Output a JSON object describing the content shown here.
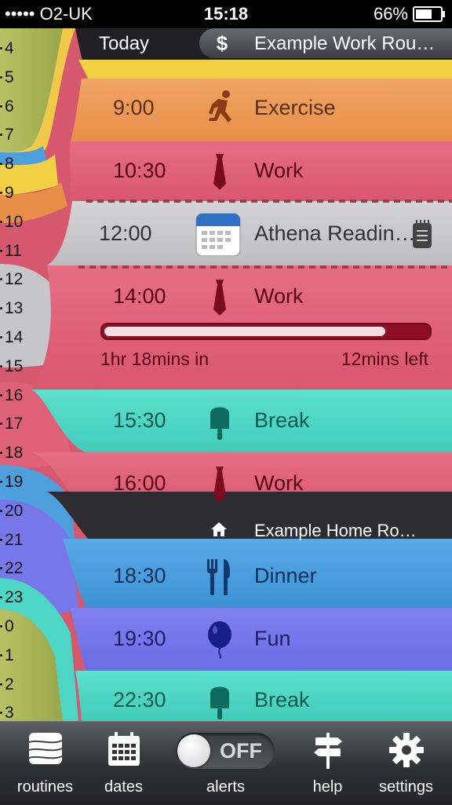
{
  "status_bar": {
    "carrier": "••••• O2-UK",
    "time": "15:18",
    "battery": "66%"
  },
  "hours": [
    "4",
    "5",
    "6",
    "7",
    "8",
    "9",
    "10",
    "11",
    "12",
    "13",
    "14",
    "15",
    "16",
    "17",
    "18",
    "19",
    "20",
    "21",
    "22",
    "23",
    "0",
    "1",
    "2",
    "3"
  ],
  "header": {
    "today_label": "Today",
    "routine_title": "Example Work Rou…",
    "routine_icon": "dollar-icon"
  },
  "events": [
    {
      "time": "9:00",
      "name": "Exercise",
      "icon": "running-person-icon",
      "color": "#ec9a56"
    },
    {
      "time": "10:30",
      "name": "Work",
      "icon": "tie-icon",
      "color": "#df6178"
    },
    {
      "time": "12:00",
      "name": "Athena Readin…",
      "icon": "calendar-icon",
      "color": "#c9c9cb"
    },
    {
      "time": "14:00",
      "name": "Work",
      "icon": "tie-icon",
      "color": "#df6178"
    },
    {
      "time": "15:30",
      "name": "Break",
      "icon": "ice-lolly-icon",
      "color": "#4ed6c4"
    },
    {
      "time": "16:00",
      "name": "Work",
      "icon": "tie-icon",
      "color": "#df6178"
    },
    {
      "time": "18:30",
      "name": "Dinner",
      "icon": "cutlery-icon",
      "color": "#4d9fdc"
    },
    {
      "time": "19:30",
      "name": "Fun",
      "icon": "balloon-icon",
      "color": "#7777ea"
    },
    {
      "time": "22:30",
      "name": "Break",
      "icon": "ice-lolly-icon",
      "color": "#4ed6c4"
    }
  ],
  "current_event": {
    "elapsed": "1hr 18mins in",
    "remaining": "12mins left",
    "progress_fraction": 0.87
  },
  "home_routine": {
    "title": "Example Home Ro…",
    "icon": "home-icon"
  },
  "tabbar": {
    "routines": "routines",
    "dates": "dates",
    "alerts": "alerts",
    "alerts_toggle": "OFF",
    "help": "help",
    "settings": "settings"
  }
}
